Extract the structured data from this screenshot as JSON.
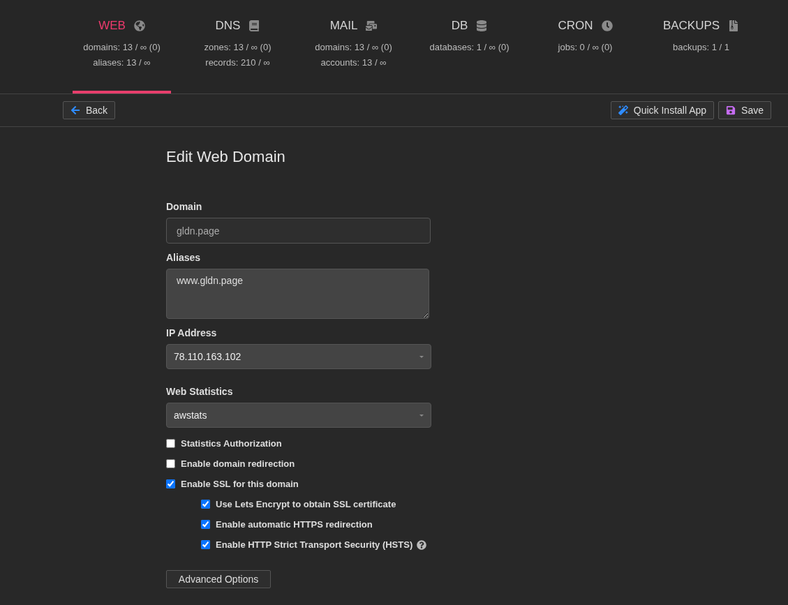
{
  "tabs": [
    {
      "label": "WEB",
      "selected": true,
      "stats": [
        "domains: 13 / ∞ (0)",
        "aliases: 13 / ∞"
      ]
    },
    {
      "label": "DNS",
      "selected": false,
      "stats": [
        "zones: 13 / ∞ (0)",
        "records: 210 / ∞"
      ]
    },
    {
      "label": "MAIL",
      "selected": false,
      "stats": [
        "domains: 13 / ∞ (0)",
        "accounts: 13 / ∞"
      ]
    },
    {
      "label": "DB",
      "selected": false,
      "stats": [
        "databases: 1 / ∞ (0)"
      ]
    },
    {
      "label": "CRON",
      "selected": false,
      "stats": [
        "jobs: 0 / ∞ (0)"
      ]
    },
    {
      "label": "BACKUPS",
      "selected": false,
      "stats": [
        "backups: 1 / 1"
      ]
    }
  ],
  "toolbar": {
    "back": "Back",
    "quick_install": "Quick Install App",
    "save": "Save"
  },
  "form": {
    "title": "Edit Web Domain",
    "fields": [
      {
        "kind": "input",
        "label": "Domain",
        "placeholder": "gldn.page"
      },
      {
        "kind": "textarea",
        "label": "Aliases",
        "value": "www.gldn.page"
      },
      {
        "kind": "select",
        "label": "IP Address",
        "value": "78.110.163.102"
      },
      {
        "kind": "select",
        "label": "Web Statistics",
        "value": "awstats"
      }
    ],
    "options": [
      {
        "label": "Statistics Authorization",
        "checked": false
      },
      {
        "label": "Enable domain redirection",
        "checked": false
      },
      {
        "label": "Enable SSL for this domain",
        "checked": true,
        "children": [
          {
            "label": "Use Lets Encrypt to obtain SSL certificate",
            "checked": true
          },
          {
            "label": "Enable automatic HTTPS redirection",
            "checked": true
          },
          {
            "label": "Enable HTTP Strict Transport Security (HSTS)",
            "checked": true,
            "help": true
          }
        ]
      }
    ],
    "advanced": "Advanced Options"
  }
}
